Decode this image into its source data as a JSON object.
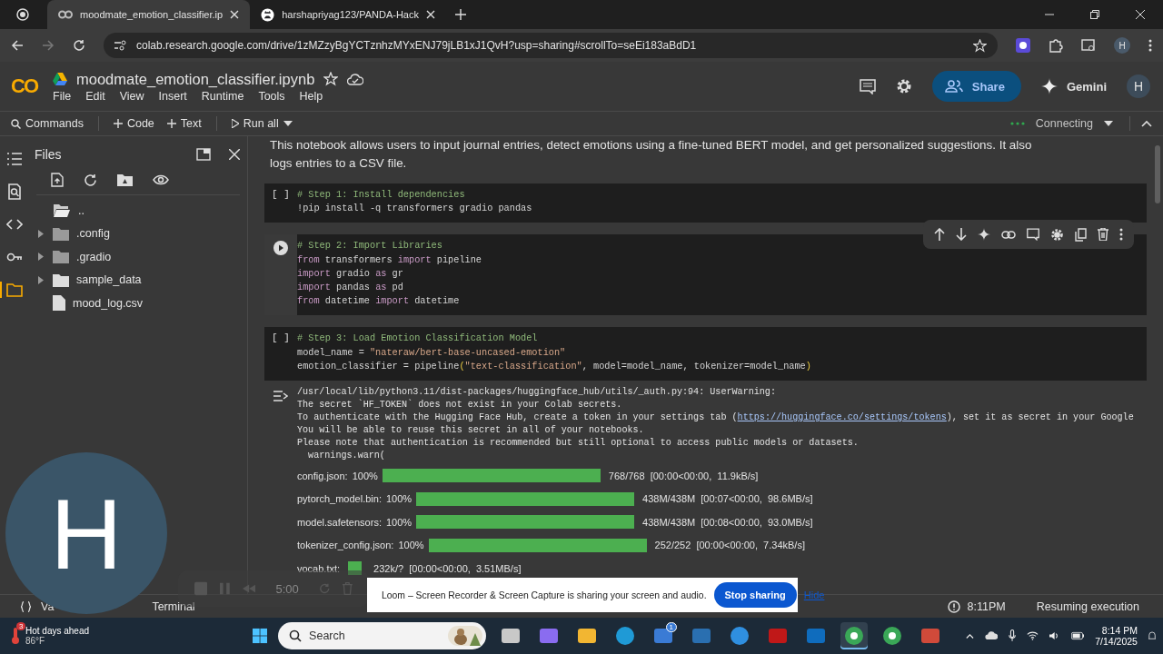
{
  "browser": {
    "tabs": [
      {
        "title": "moodmate_emotion_classifier.ip",
        "kind": "colab",
        "selected": true
      },
      {
        "title": "harshapriyag123/PANDA-Hack",
        "kind": "github",
        "selected": false
      }
    ],
    "url": "colab.research.google.com/drive/1zMZzyBgYCTznhzMYxENJ79jLB1xJ1QvH?usp=sharing#scrollTo=seEi183aBdD1",
    "profile": "H"
  },
  "colab": {
    "logo": "CO",
    "title": "moodmate_emotion_classifier.ipynb",
    "menu": [
      "File",
      "Edit",
      "View",
      "Insert",
      "Runtime",
      "Tools",
      "Help"
    ],
    "share": "Share",
    "gemini": "Gemini",
    "avatar": "H"
  },
  "toolbar": {
    "items": [
      {
        "kind": "commands",
        "label": "Commands"
      },
      {
        "kind": "add",
        "label": "Code"
      },
      {
        "kind": "add",
        "label": "Text"
      },
      {
        "kind": "run",
        "label": "Run all"
      }
    ],
    "status": "Connecting"
  },
  "rail": [
    {
      "kind": "toc",
      "selected": false
    },
    {
      "kind": "find",
      "selected": false
    },
    {
      "kind": "snippets",
      "selected": false
    },
    {
      "kind": "secrets",
      "selected": false
    },
    {
      "kind": "files",
      "selected": true
    }
  ],
  "files": {
    "title": "Files",
    "items": [
      {
        "kind": "parent",
        "name": ".."
      },
      {
        "kind": "folder",
        "name": ".config",
        "expanded": false
      },
      {
        "kind": "folder",
        "name": ".gradio",
        "expanded": false
      },
      {
        "kind": "folder",
        "name": "sample_data",
        "expanded": false
      },
      {
        "kind": "file",
        "name": "mood_log.csv"
      }
    ]
  },
  "notebook": {
    "intro": "This notebook allows users to input journal entries, detect emotions using a fine-tuned BERT model, and get personalized suggestions. It also logs entries to a CSV file.",
    "cells": [
      {
        "focused": false,
        "prompt": "[ ]",
        "lines": [
          [
            {
              "kind": "comment",
              "s": "# Step 1: Install dependencies"
            }
          ],
          [
            {
              "s": "!pip install -q transformers gradio pandas"
            }
          ]
        ]
      },
      {
        "focused": true,
        "lines": [
          [
            {
              "kind": "comment",
              "s": "# Step 2: Import Libraries"
            }
          ],
          [
            {
              "kind": "keyword",
              "s": "from"
            },
            {
              "s": " transformers "
            },
            {
              "kind": "keyword",
              "s": "import"
            },
            {
              "s": " pipeline"
            }
          ],
          [
            {
              "kind": "keyword",
              "s": "import"
            },
            {
              "s": " gradio "
            },
            {
              "kind": "keyword",
              "s": "as"
            },
            {
              "s": " gr"
            }
          ],
          [
            {
              "kind": "keyword",
              "s": "import"
            },
            {
              "s": " pandas "
            },
            {
              "kind": "keyword",
              "s": "as"
            },
            {
              "s": " pd"
            }
          ],
          [
            {
              "kind": "keyword",
              "s": "from"
            },
            {
              "s": " datetime "
            },
            {
              "kind": "keyword",
              "s": "import"
            },
            {
              "s": " datetime"
            }
          ]
        ]
      },
      {
        "focused": false,
        "prompt": "[ ]",
        "lines": [
          [
            {
              "kind": "comment",
              "s": "# Step 3: Load Emotion Classification Model"
            }
          ],
          [
            {
              "s": "model_name = "
            },
            {
              "kind": "string",
              "s": "\"nateraw/bert-base-uncased-emotion\""
            }
          ],
          [
            {
              "s": "emotion_classifier = pipeline"
            },
            {
              "kind": "paren",
              "s": "("
            },
            {
              "kind": "string",
              "s": "\"text-classification\""
            },
            {
              "s": ", model=model_name, tokenizer=model_name"
            },
            {
              "kind": "paren",
              "s": ")"
            }
          ]
        ],
        "output": {
          "lines": [
            {
              "text": "/usr/local/lib/python3.11/dist-packages/huggingface_hub/utils/_auth.py:94: UserWarning:"
            },
            {
              "text": "The secret `HF_TOKEN` does not exist in your Colab secrets."
            },
            {
              "text": "To authenticate with the Hugging Face Hub, create a token in your settings tab (",
              "link": "https://huggingface.co/settings/tokens",
              "after": "), set it as secret in your Google"
            },
            {
              "text": "You will be able to reuse this secret in all of your notebooks."
            },
            {
              "text": "Please note that authentication is recommended but still optional to access public models or datasets."
            },
            {
              "text": "  warnings.warn("
            }
          ],
          "progress": [
            {
              "kind": "total",
              "label": "config.json:",
              "percent": "100%",
              "stats": "768/768  [00:00<00:00,  11.9kB/s]"
            },
            {
              "kind": "total",
              "label": "pytorch_model.bin:",
              "percent": "100%",
              "stats": "438M/438M  [00:07<00:00,  98.6MB/s]"
            },
            {
              "kind": "total",
              "label": "model.safetensors:",
              "percent": "100%",
              "stats": "438M/438M  [00:08<00:00,  93.0MB/s]"
            },
            {
              "kind": "total",
              "label": "tokenizer_config.json:",
              "percent": "100%",
              "stats": "252/252  [00:00<00:00,  7.34kB/s]"
            },
            {
              "kind": "unknown",
              "label": "vocab.txt:",
              "stats": "232k/?  [00:00<00:00,  3.51MB/s]"
            }
          ]
        }
      }
    ]
  },
  "status_bar": {
    "variables": "Va",
    "terminal": "Terminal",
    "time": "8:11PM",
    "message": "Resuming execution"
  },
  "loom": {
    "initial": "H",
    "timer": "5:00",
    "notice": "Loom – Screen Recorder & Screen Capture is sharing your screen and audio.",
    "stop": "Stop sharing",
    "hide": "Hide"
  },
  "taskbar": {
    "weather": {
      "badge": "3",
      "title": "Hot days ahead",
      "temp": "86°F"
    },
    "search": "Search",
    "apps": [
      {
        "kind": "taskview",
        "active": false
      },
      {
        "kind": "copilot",
        "active": false
      },
      {
        "kind": "explorer",
        "active": false
      },
      {
        "kind": "edge",
        "active": false
      },
      {
        "kind": "store",
        "active": false,
        "badge": "1"
      },
      {
        "kind": "blue",
        "active": false
      },
      {
        "kind": "help",
        "active": false
      },
      {
        "kind": "mcafee",
        "active": false
      },
      {
        "kind": "outlook",
        "active": false
      },
      {
        "kind": "chrome",
        "active": true
      },
      {
        "kind": "chrome",
        "active": false
      },
      {
        "kind": "snip",
        "active": false
      }
    ],
    "time": "8:14 PM",
    "date": "7/14/2025"
  }
}
